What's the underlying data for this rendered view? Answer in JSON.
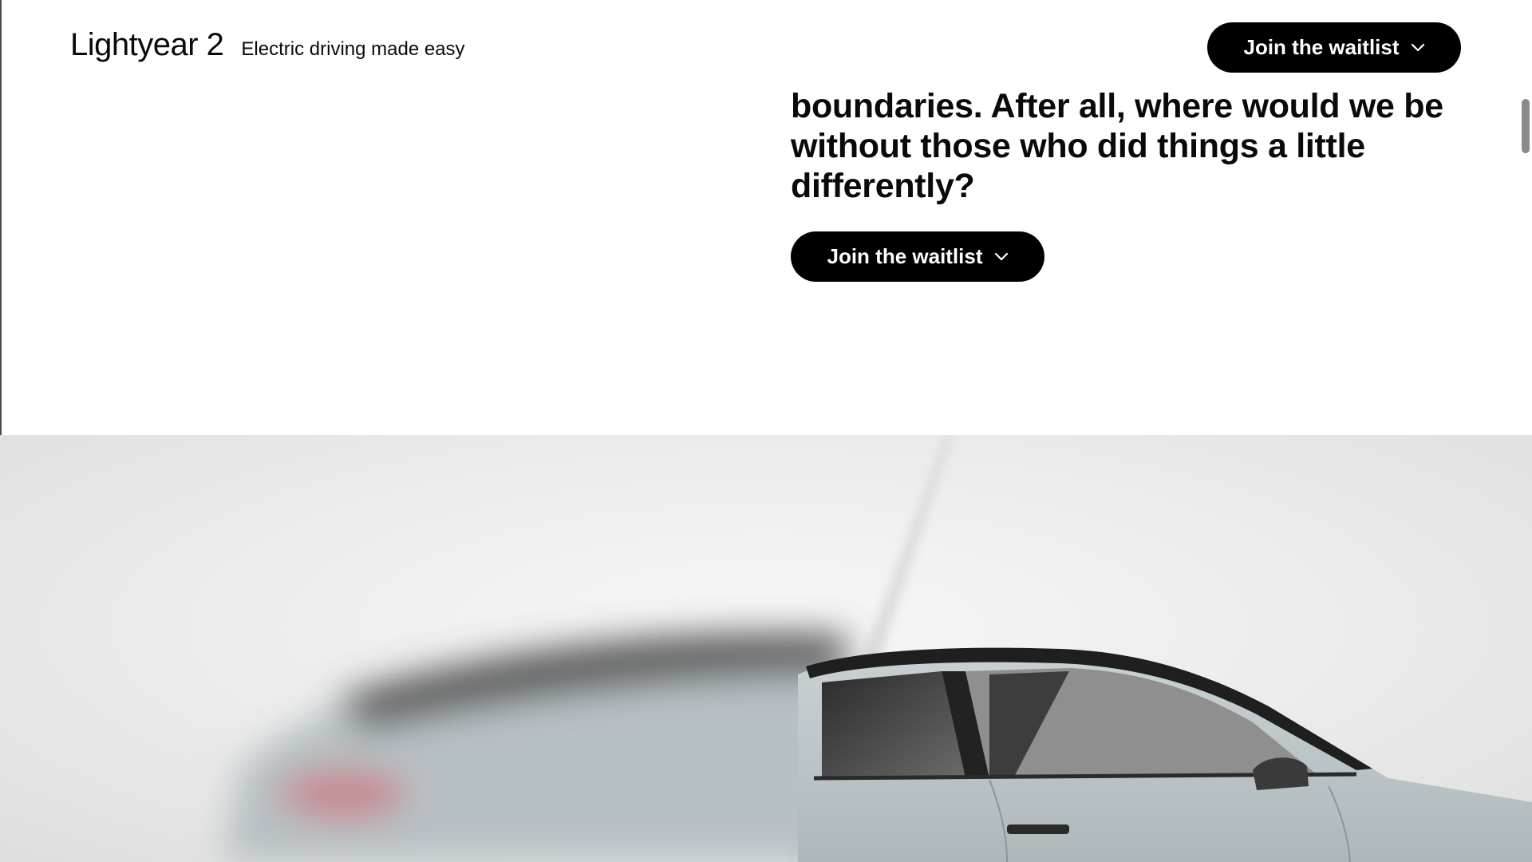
{
  "header": {
    "brand_name": "Lightyear 2",
    "tagline": "Electric driving made easy",
    "cta_label": "Join the waitlist",
    "cta_icon": "chevron-down-icon"
  },
  "hero": {
    "text": "boundaries. After all, where would we be without those who did things a little differently?",
    "cta_label": "Join the waitlist",
    "cta_icon": "chevron-down-icon"
  },
  "car_image": {
    "subject": "car-photo",
    "colors": {
      "body": "#b9c3c6",
      "glass": "#3a3a3a",
      "background": "#ededed",
      "taillight": "#c8858d"
    }
  },
  "colors": {
    "button_bg": "#000000",
    "button_text": "#ffffff",
    "page_bg": "#ffffff"
  }
}
